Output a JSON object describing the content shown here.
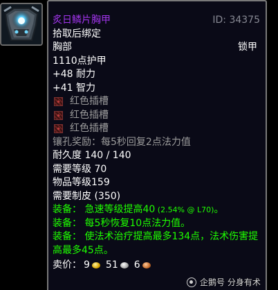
{
  "item": {
    "name": "炙日鳞片胸甲",
    "id_label": "ID: 34375",
    "bind": "拾取后绑定",
    "slot": "胸部",
    "armor_type": "锁甲",
    "armor": "1110点护甲",
    "stats": [
      "+48 耐力",
      "+41 智力"
    ],
    "sockets": [
      "红色插槽",
      "红色插槽",
      "红色插槽"
    ],
    "socket_bonus": "镶孔奖励：每5秒回复2点法力值",
    "durability": "耐久度 140 / 140",
    "required_level": "需要等级 70",
    "item_level": "物品等级159",
    "required_skill": "需要制皮 (350)",
    "equip_effects": [
      {
        "prefix": "装备：",
        "text": "急速等级提高40",
        "small": " (2.54% @ L70)",
        "suffix": "。"
      },
      {
        "prefix": "装备：",
        "text": "每5秒恢复10点法力值。"
      },
      {
        "prefix": "装备：",
        "text": "使法术治疗提高最多134点，法术伤害提高最多45点。"
      }
    ],
    "sell_label": "卖价：",
    "sell_gold": "9",
    "sell_silver": "51",
    "sell_copper": "6"
  },
  "colors": {
    "epic": "#a335ee",
    "equip": "#1eff00",
    "socket": "#9c9c9c"
  },
  "icons": {
    "item_icon": "chest-armor-icon",
    "socket_icon": "red-socket-icon"
  },
  "watermark": {
    "text": "企鹅号 分身有术"
  }
}
